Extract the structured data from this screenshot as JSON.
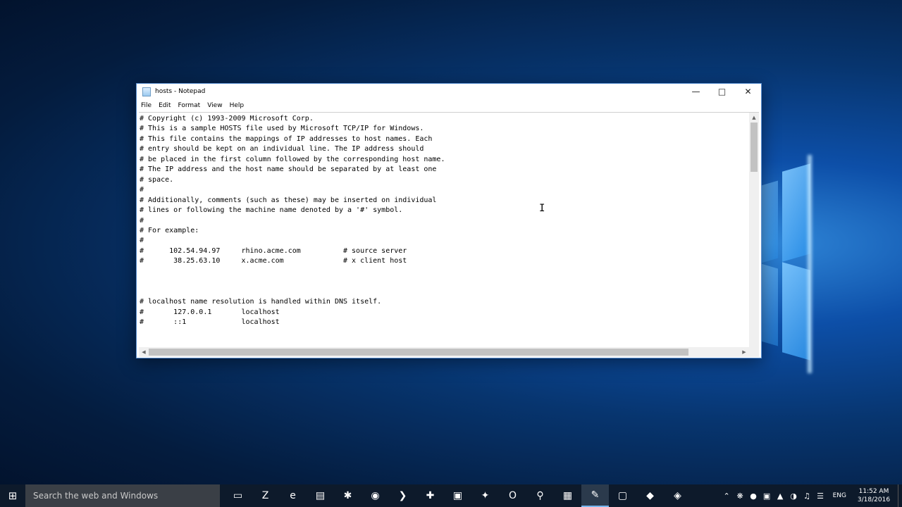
{
  "window": {
    "title": "hosts - Notepad",
    "menu": [
      "File",
      "Edit",
      "Format",
      "View",
      "Help"
    ]
  },
  "document": {
    "lines": [
      "# Copyright (c) 1993-2009 Microsoft Corp.",
      "# This is a sample HOSTS file used by Microsoft TCP/IP for Windows.",
      "# This file contains the mappings of IP addresses to host names. Each",
      "# entry should be kept on an individual line. The IP address should",
      "# be placed in the first column followed by the corresponding host name.",
      "# The IP address and the host name should be separated by at least one",
      "# space.",
      "#",
      "# Additionally, comments (such as these) may be inserted on individual",
      "# lines or following the machine name denoted by a '#' symbol.",
      "#",
      "# For example:",
      "#",
      "#      102.54.94.97     rhino.acme.com          # source server",
      "#       38.25.63.10     x.acme.com              # x client host",
      "",
      "",
      "",
      "# localhost name resolution is handled within DNS itself.",
      "#\t127.0.0.1       localhost",
      "#\t::1             localhost"
    ]
  },
  "taskbar": {
    "search_placeholder": "Search the web and Windows",
    "apps": [
      {
        "name": "task-view-icon",
        "glyph": "▭"
      },
      {
        "name": "filezilla-icon",
        "glyph": "Z"
      },
      {
        "name": "edge-icon",
        "glyph": "e"
      },
      {
        "name": "file-explorer-icon",
        "glyph": "▤"
      },
      {
        "name": "settings-tool-icon",
        "glyph": "✱"
      },
      {
        "name": "chrome-icon",
        "glyph": "◉"
      },
      {
        "name": "powershell-icon",
        "glyph": "❯"
      },
      {
        "name": "network-tool-icon",
        "glyph": "✚"
      },
      {
        "name": "remote-desktop-icon",
        "glyph": "▣"
      },
      {
        "name": "utility-icon",
        "glyph": "✦"
      },
      {
        "name": "outlook-icon",
        "glyph": "O"
      },
      {
        "name": "search-tool-icon",
        "glyph": "⚲"
      },
      {
        "name": "calculator-icon",
        "glyph": "▦"
      },
      {
        "name": "notepad-icon",
        "glyph": "✎"
      },
      {
        "name": "monitor-icon",
        "glyph": "▢"
      },
      {
        "name": "app-icon-1",
        "glyph": "◆"
      },
      {
        "name": "app-icon-2",
        "glyph": "◈"
      }
    ],
    "language": "ENG",
    "time": "11:52 AM",
    "date": "3/18/2016"
  }
}
